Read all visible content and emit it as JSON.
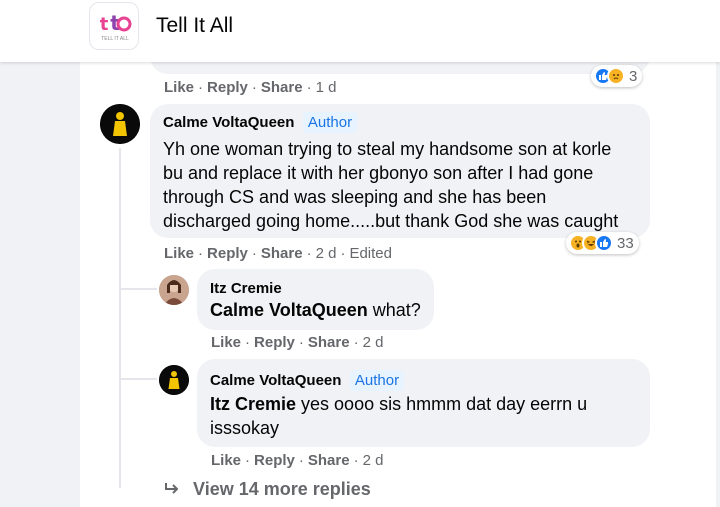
{
  "page": {
    "title": "Tell It All",
    "logo_text": "TELL IT ALL"
  },
  "comments": [
    {
      "actions": {
        "like": "Like",
        "reply": "Reply",
        "share": "Share",
        "time": "1 d"
      },
      "reactions": {
        "count": "3",
        "types": [
          "like-icon",
          "sad-icon"
        ]
      }
    },
    {
      "author": "Calme VoltaQueen",
      "badge": "Author",
      "lines": [
        "Yh one woman trying to steal my handsome son at korle",
        "bu and replace it with her gbonyo son after I had gone",
        "through CS and was sleeping and she has been",
        "discharged going home.....but thank God she was caught"
      ],
      "actions": {
        "like": "Like",
        "reply": "Reply",
        "share": "Share",
        "time": "2 d",
        "edited": "Edited"
      },
      "reactions": {
        "count": "33",
        "types": [
          "wow-icon",
          "haha-icon",
          "like-icon"
        ]
      }
    }
  ],
  "replies": [
    {
      "author": "Itz Cremie",
      "mention": "Calme VoltaQueen",
      "text": " what?",
      "actions": {
        "like": "Like",
        "reply": "Reply",
        "share": "Share",
        "time": "2 d"
      }
    },
    {
      "author": "Calme VoltaQueen",
      "badge": "Author",
      "mention": "Itz Cremie",
      "text": " yes oooo sis hmmm dat day eerrn u",
      "text2": "isssokay",
      "actions": {
        "like": "Like",
        "reply": "Reply",
        "share": "Share",
        "time": "2 d"
      }
    }
  ],
  "view_more": "View 14 more replies",
  "colors": {
    "accent": "#1b74e4",
    "like": "#1877f2",
    "emoji": "#f7b125"
  }
}
